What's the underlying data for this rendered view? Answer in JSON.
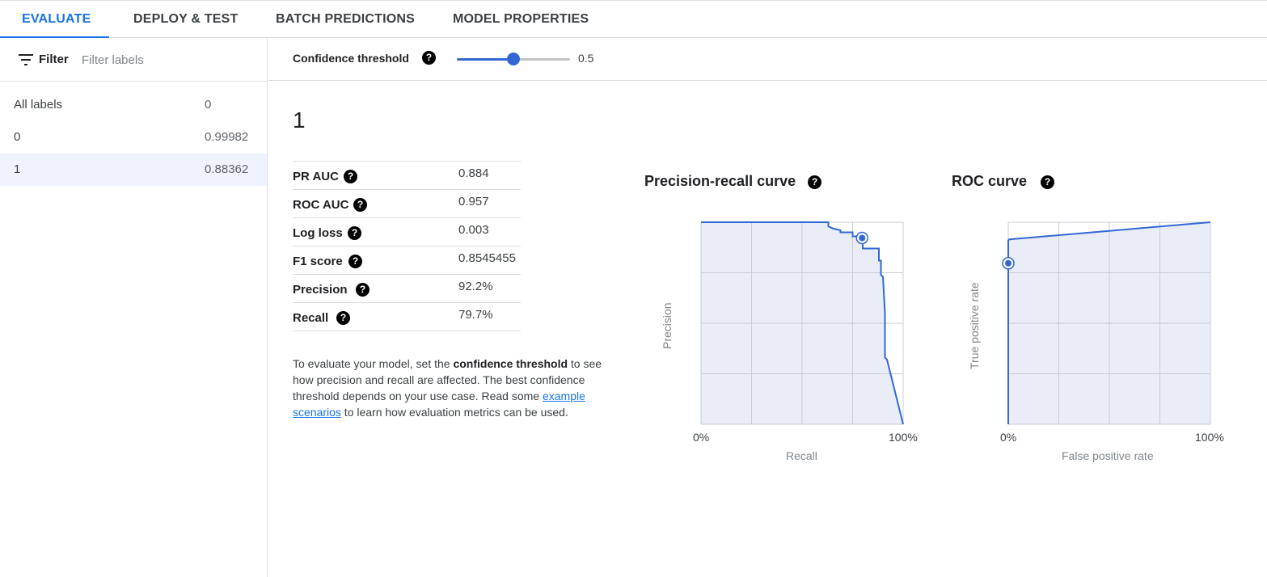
{
  "tabs": [
    {
      "label": "EVALUATE",
      "active": true
    },
    {
      "label": "DEPLOY & TEST",
      "active": false
    },
    {
      "label": "BATCH PREDICTIONS",
      "active": false
    },
    {
      "label": "MODEL PROPERTIES",
      "active": false
    }
  ],
  "sidebar": {
    "filter_label": "Filter",
    "filter_placeholder": "Filter labels",
    "items": [
      {
        "name": "All labels",
        "value": "0",
        "selected": false
      },
      {
        "name": "0",
        "value": "0.99982",
        "selected": false
      },
      {
        "name": "1",
        "value": "0.88362",
        "selected": true
      }
    ]
  },
  "threshold": {
    "label": "Confidence threshold",
    "value": 0.5,
    "value_text": "0.5"
  },
  "main": {
    "label_title": "1",
    "metrics": [
      {
        "name": "PR AUC",
        "value": "0.884"
      },
      {
        "name": "ROC AUC",
        "value": "0.957"
      },
      {
        "name": "Log loss",
        "value": "0.003"
      },
      {
        "name": "F1 score",
        "value": "0.8545455"
      },
      {
        "name": "Precision",
        "value": "92.2%"
      },
      {
        "name": "Recall",
        "value": "79.7%"
      }
    ],
    "description": {
      "part1": "To evaluate your model, set the ",
      "bold": "confidence threshold",
      "part2": " to see how precision and recall are affected. The best confidence threshold depends on your use case. Read some ",
      "link": "example scenarios",
      "part3": " to learn how evaluation metrics can be used."
    }
  },
  "help_icon": "help-circle-icon",
  "colors": {
    "accent": "#1a73e8",
    "curve": "#3367d6",
    "plot_fill": "#e8edf8",
    "grid": "#c8ccd4"
  },
  "chart_data": [
    {
      "type": "line",
      "title": "Precision-recall curve",
      "xlabel": "Recall",
      "ylabel": "Precision",
      "x_ticks": [
        "0%",
        "100%"
      ],
      "xlim": [
        0,
        1
      ],
      "ylim": [
        0,
        1
      ],
      "grid": true,
      "area_fill": true,
      "series": [
        {
          "x": [
            0,
            0.63,
            0.63,
            0.65,
            0.69,
            0.69,
            0.75,
            0.75,
            0.79,
            0.8,
            0.8,
            0.88,
            0.88,
            0.89,
            0.89,
            0.9,
            0.91,
            0.91,
            0.92,
            1.0
          ],
          "y": [
            1.0,
            1.0,
            0.98,
            0.97,
            0.96,
            0.95,
            0.95,
            0.93,
            0.93,
            0.93,
            0.87,
            0.87,
            0.81,
            0.81,
            0.74,
            0.73,
            0.55,
            0.33,
            0.32,
            0.0
          ]
        }
      ],
      "threshold_point": {
        "x": 0.797,
        "y": 0.922
      },
      "threshold_line_x": 0.75
    },
    {
      "type": "line",
      "title": "ROC curve",
      "xlabel": "False positive rate",
      "ylabel": "True positive rate",
      "x_ticks": [
        "0%",
        "100%"
      ],
      "xlim": [
        0,
        1
      ],
      "ylim": [
        0,
        1
      ],
      "grid": true,
      "area_fill": true,
      "series": [
        {
          "x": [
            0,
            0,
            0.005,
            1.0
          ],
          "y": [
            0,
            0.91,
            0.915,
            1.0
          ]
        }
      ],
      "threshold_point": {
        "x": 0.0,
        "y": 0.797
      }
    }
  ]
}
